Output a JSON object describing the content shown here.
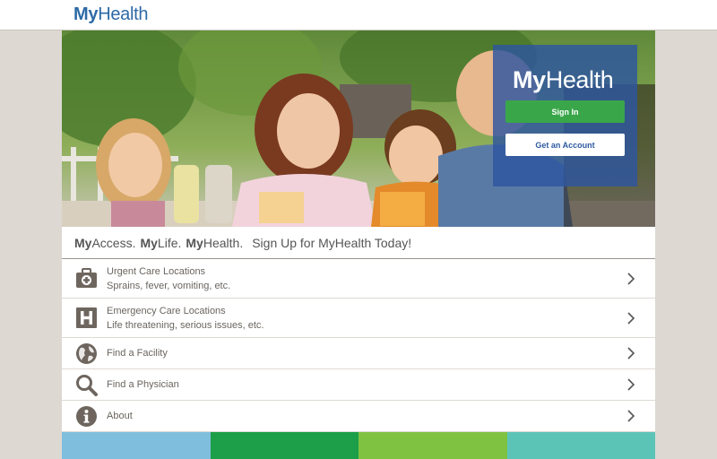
{
  "header": {
    "logo_bold": "My",
    "logo_rest": "Health"
  },
  "login": {
    "logo_bold": "My",
    "logo_rest": "Health",
    "signin_label": "Sign In",
    "account_label": "Get an Account"
  },
  "tagline": {
    "my1": "My",
    "w1": "Access.",
    "my2": "My",
    "w2": "Life.",
    "my3": "My",
    "w3": "Health.",
    "cta": "Sign Up for MyHealth Today!"
  },
  "menu": [
    {
      "icon": "first-aid-kit-icon",
      "title": "Urgent Care Locations",
      "subtitle": "Sprains, fever, vomiting, etc."
    },
    {
      "icon": "hospital-icon",
      "title": "Emergency Care Locations",
      "subtitle": "Life threatening, serious issues, etc."
    },
    {
      "icon": "globe-icon",
      "title": "Find a Facility"
    },
    {
      "icon": "search-icon",
      "title": "Find a Physician"
    },
    {
      "icon": "info-icon",
      "title": "About"
    }
  ],
  "colors": {
    "brand_blue": "#2d6aa6",
    "signin_green": "#3aa64a",
    "tiles": [
      "#7fbedc",
      "#1c9f48",
      "#7fc242",
      "#5cc4b7"
    ]
  }
}
